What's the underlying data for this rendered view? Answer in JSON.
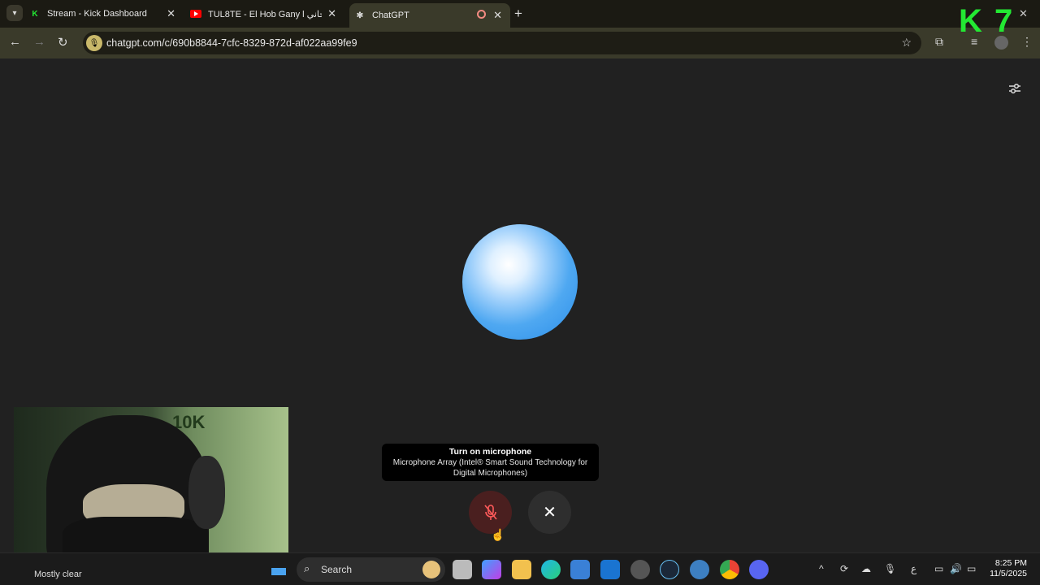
{
  "browser": {
    "tabs": [
      {
        "title": "Stream - Kick Dashboard",
        "favicon": "kick-icon",
        "active": false
      },
      {
        "title": "TUL8TE - El Hob Gany l حب جاني",
        "favicon": "youtube-icon",
        "active": false
      },
      {
        "title": "ChatGPT",
        "favicon": "chatgpt-icon",
        "active": true
      }
    ],
    "url": "chatgpt.com/c/690b8844-7cfc-8329-872d-af022aa99fe9"
  },
  "overlay": {
    "logo_text": "K 7",
    "logo_color": "#23e833"
  },
  "voice_mode": {
    "tooltip_title": "Turn on microphone",
    "tooltip_detail": "Microphone Array (Intel® Smart Sound Technology for Digital Microphones)",
    "mic_button_icon": "mic-off-icon",
    "close_button_icon": "close-icon",
    "orb_color": "#2a8de9"
  },
  "webcam": {
    "wall_text": "10K"
  },
  "taskbar": {
    "weather": "Mostly clear",
    "search_label": "Search",
    "time": "8:25 PM",
    "date": "11/5/2025",
    "language": "ع"
  }
}
